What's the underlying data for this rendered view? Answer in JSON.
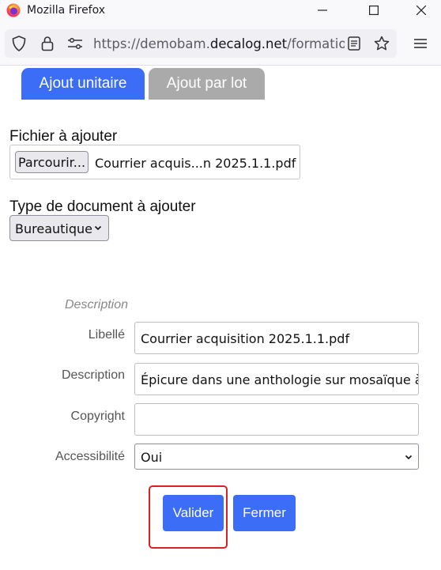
{
  "window": {
    "title": "Mozilla Firefox"
  },
  "browser": {
    "url_prefix": "https://demobam.",
    "url_domain": "decalog.net",
    "url_suffix": "/formationv"
  },
  "tabs": [
    {
      "label": "Ajout unitaire"
    },
    {
      "label": "Ajout par lot"
    }
  ],
  "form": {
    "file_label": "Fichier à ajouter",
    "browse_label": "Parcourir...",
    "file_name": "Courrier acquis...n 2025.1.1.pdf",
    "doctype_label": "Type de document à ajouter",
    "doctype_value": "Bureautique",
    "legend": "Description",
    "fields": {
      "libelle": {
        "label": "Libellé",
        "value": "Courrier acquisition 2025.1.1.pdf"
      },
      "description": {
        "label": "Description",
        "value": "Épicure dans une anthologie sur mosaïque à Aut"
      },
      "copyright": {
        "label": "Copyright",
        "value": ""
      },
      "accessibilite": {
        "label": "Accessibilité",
        "value": "Oui"
      }
    }
  },
  "actions": {
    "validate": "Valider",
    "close": "Fermer"
  }
}
